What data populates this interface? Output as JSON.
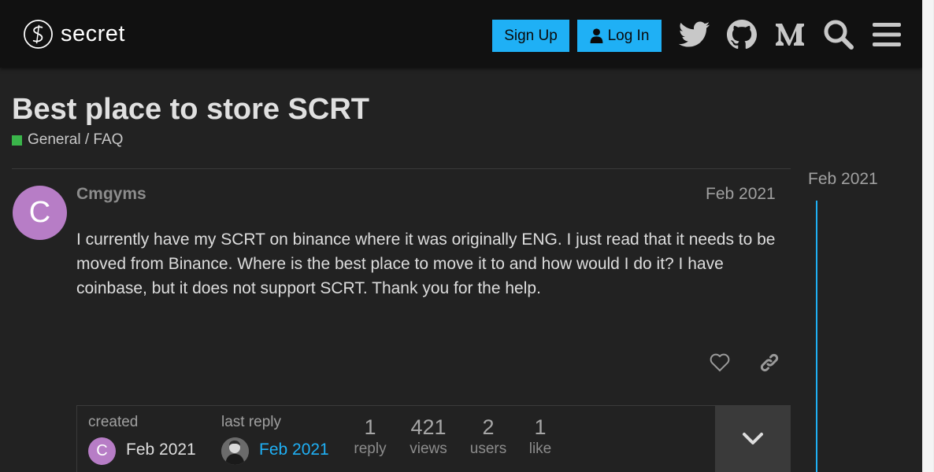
{
  "header": {
    "logo_text": "secret",
    "signup_label": "Sign Up",
    "login_label": "Log In",
    "icons": [
      "twitter-icon",
      "github-icon",
      "medium-icon",
      "search-icon",
      "hamburger-menu-icon"
    ]
  },
  "topic": {
    "title": "Best place to store SCRT",
    "category": "General / FAQ",
    "category_color": "#3ab54a"
  },
  "post": {
    "avatar_letter": "C",
    "avatar_color": "#b77dc6",
    "username": "Cmgyms",
    "date": "Feb 2021",
    "body": "I currently have my SCRT on binance where it was originally ENG. I just read that it needs to be moved from Binance. Where is the best place to move it to and how would I do it? I have coinbase, but it does not support SCRT. Thank you for the help."
  },
  "topic_map": {
    "created_label": "created",
    "created_avatar_letter": "C",
    "created_date": "Feb 2021",
    "last_reply_label": "last reply",
    "last_reply_date": "Feb 2021",
    "stats": [
      {
        "num": "1",
        "label": "reply"
      },
      {
        "num": "421",
        "label": "views"
      },
      {
        "num": "2",
        "label": "users"
      },
      {
        "num": "1",
        "label": "like"
      }
    ]
  },
  "timeline": {
    "date": "Feb 2021"
  },
  "colors": {
    "accent": "#1fb0f5",
    "background": "#222222",
    "header": "#111111"
  }
}
